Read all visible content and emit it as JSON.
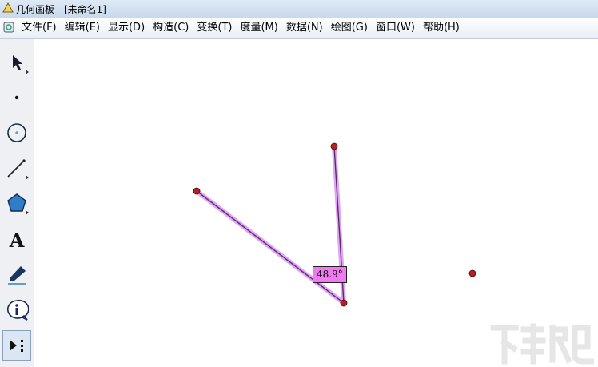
{
  "window": {
    "title": "几何画板 - [未命名1]"
  },
  "menu": [
    "文件(F)",
    "编辑(E)",
    "显示(D)",
    "构造(C)",
    "变换(T)",
    "度量(M)",
    "数据(N)",
    "绘图(G)",
    "窗口(W)",
    "帮助(H)"
  ],
  "toolbox": {
    "tools": [
      "arrow-select-icon",
      "point-tool-icon",
      "compass-tool-icon",
      "straightedge-tool-icon",
      "polygon-tool-icon",
      "text-tool-icon",
      "marker-tool-icon",
      "information-tool-icon",
      "custom-tool-icon"
    ],
    "text_tool_glyph": "A",
    "selected": "custom-tool-icon"
  },
  "canvas": {
    "angle_measure": "48.9°",
    "colors": {
      "point": "#b22222",
      "segment": "#5a2a6e",
      "segment_highlight": "#e0a6f2",
      "label_bg": "#f07af0"
    }
  }
}
